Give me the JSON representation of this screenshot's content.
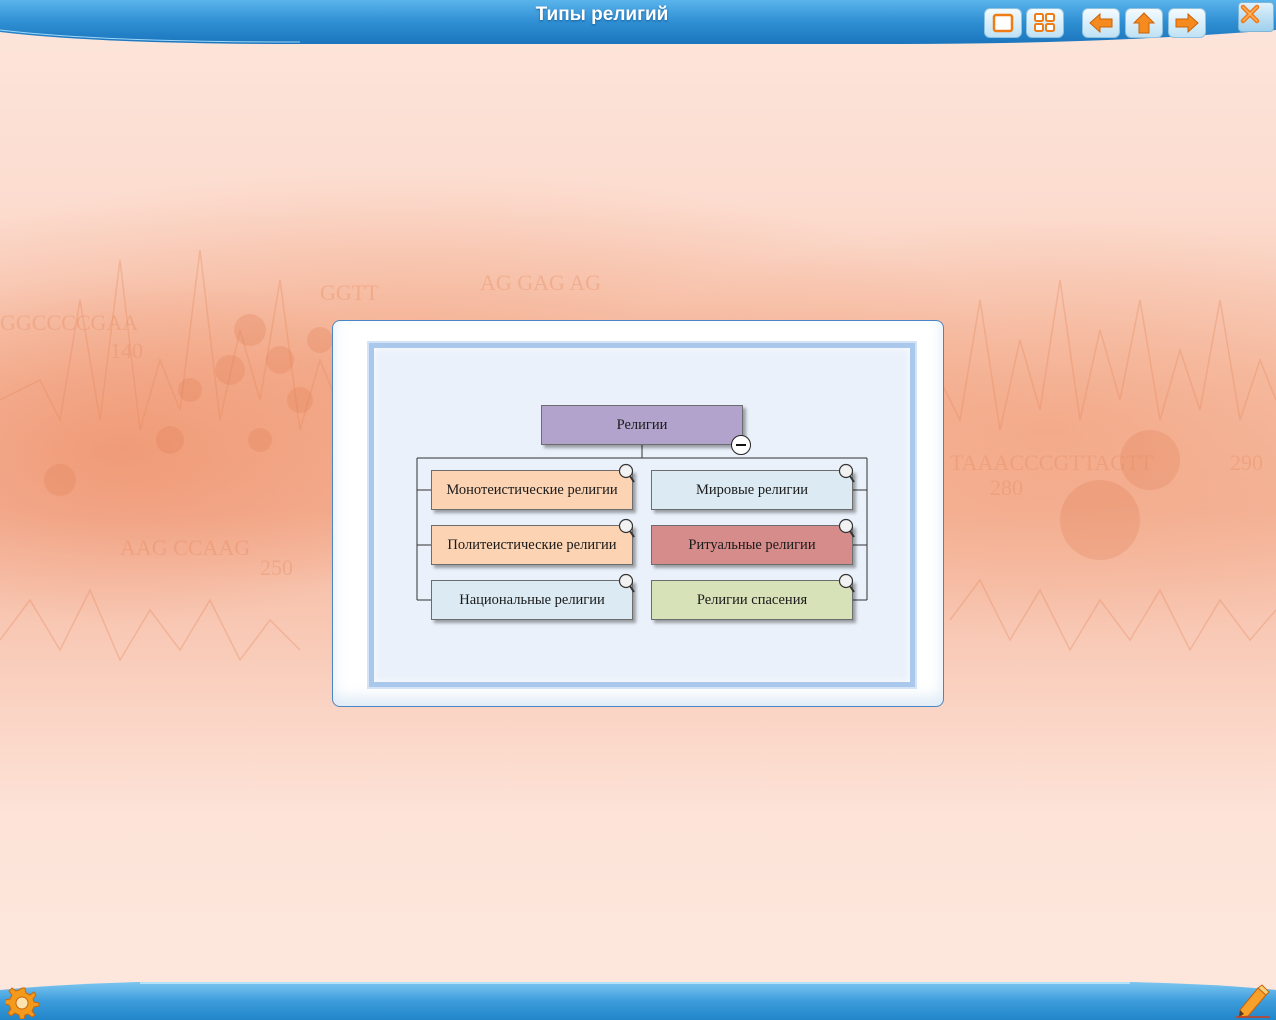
{
  "window": {
    "title": "Типы религий"
  },
  "diagram": {
    "root": "Религии",
    "left_column": [
      "Монотеистические религии",
      "Политеистические религии",
      "Национальные религии"
    ],
    "right_column": [
      "Мировые религии",
      "Ритуальные религии",
      "Религии спасения"
    ]
  },
  "colors": {
    "title_bar": "#2f8fd3",
    "root_node": "#b1a3cb",
    "monotheistic_node": "#fdd4b3",
    "polytheistic_node": "#fdd4b3",
    "national_node": "#dcebf3",
    "world_node": "#dcebf3",
    "ritual_node": "#d68c8b",
    "salvation_node": "#d7e2b8"
  },
  "icons": {
    "close": "close-icon",
    "settings": "gear-icon",
    "window": "window-icon",
    "grid": "grid-icon",
    "back": "arrow-left-icon",
    "home": "arrow-up-icon",
    "forward": "arrow-right-icon",
    "notes": "pencil-icon",
    "zoom": "magnifier-icon",
    "collapse": "minus-circle-icon"
  }
}
